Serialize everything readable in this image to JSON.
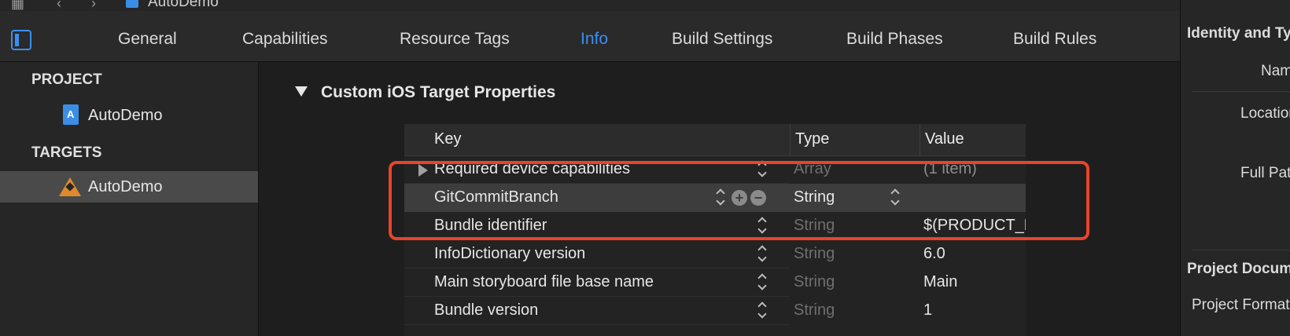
{
  "window": {
    "title": "AutoDemo"
  },
  "tabs": [
    {
      "label": "General"
    },
    {
      "label": "Capabilities"
    },
    {
      "label": "Resource Tags"
    },
    {
      "label": "Info"
    },
    {
      "label": "Build Settings"
    },
    {
      "label": "Build Phases"
    },
    {
      "label": "Build Rules"
    }
  ],
  "active_tab": "Info",
  "navigator": {
    "project_header": "PROJECT",
    "project_item": "AutoDemo",
    "targets_header": "TARGETS",
    "target_item": "AutoDemo"
  },
  "section": {
    "title": "Custom iOS Target Properties"
  },
  "table": {
    "headers": {
      "key": "Key",
      "type": "Type",
      "value": "Value"
    },
    "rows": [
      {
        "key": "Required device capabilities",
        "type": "Array",
        "value": "(1 item)"
      },
      {
        "key": "GitCommitBranch",
        "type": "String",
        "value": ""
      },
      {
        "key": "Bundle identifier",
        "type": "String",
        "value": "$(PRODUCT_BUNDLE_IDENTIFIER)"
      },
      {
        "key": "InfoDictionary version",
        "type": "String",
        "value": "6.0"
      },
      {
        "key": "Main storyboard file base name",
        "type": "String",
        "value": "Main"
      },
      {
        "key": "Bundle version",
        "type": "String",
        "value": "1"
      }
    ]
  },
  "inspector": {
    "identity_header": "Identity and Type",
    "name_label": "Name",
    "location_label": "Location",
    "full_path_label": "Full Path",
    "project_doc_header": "Project Document",
    "project_format_label": "Project Format"
  },
  "colors": {
    "accent": "#3b8ff1",
    "highlight": "#e8442a",
    "background": "#1e1e1e"
  }
}
